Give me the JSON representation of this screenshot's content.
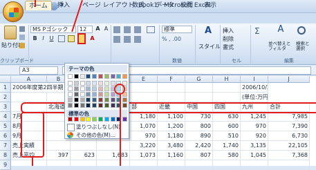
{
  "window": {
    "title": "Book1 - Microsoft Excel"
  },
  "tabs": [
    "ホーム",
    "挿入",
    "ページ レイアウト",
    "数式",
    "データ",
    "校閲",
    "表示"
  ],
  "ribbon": {
    "paste_label": "貼り付け",
    "clipboard_label": "クリップボード",
    "font_name": "MS Pゴシック",
    "font_size": "12",
    "number_format": "標準",
    "number_label": "数値",
    "style_label": "スタイル",
    "cells_insert": "挿入",
    "cells_delete": "削除",
    "cells_format": "書式",
    "cells_label": "セル",
    "sort_label": "並べ替えと\nフィルタ",
    "find_label": "検索と\n選択",
    "edit_label": "編集",
    "bold": "B",
    "italic": "I",
    "underline": "U",
    "font_color_glyph": "A"
  },
  "formula_bar": {
    "name_box": "A3"
  },
  "palette": {
    "theme_header": "テーマの色",
    "standard_header": "標準の色",
    "no_fill": "塗りつぶしなし(N)",
    "more_colors": "その他の色(M)...",
    "theme_top": [
      "#ffffff",
      "#000000",
      "#eeece1",
      "#1f497d",
      "#4f81bd",
      "#c0504d",
      "#9bbb59",
      "#8064a2",
      "#4bacc6",
      "#f79646"
    ],
    "standard": [
      "#c00000",
      "#ff0000",
      "#ffc000",
      "#ffff00",
      "#92d050",
      "#00b050",
      "#00b0f0",
      "#0070c0",
      "#002060",
      "#7030a0"
    ]
  },
  "sheet": {
    "columns": [
      "A",
      "B",
      "C",
      "D",
      "E",
      "F",
      "G",
      "H",
      "I",
      "J"
    ],
    "rows": [
      {
        "n": "1",
        "cells": [
          "2006年度第2四半期",
          "",
          "",
          "",
          "",
          "",
          "",
          "",
          "2006/10/25"
        ]
      },
      {
        "n": "2",
        "cells": [
          "",
          "",
          "",
          "",
          "",
          "",
          "",
          "",
          "(単位:万円)"
        ]
      },
      {
        "n": "3",
        "cells": [
          "",
          "北海道",
          "",
          "",
          "部",
          "近畿",
          "中国",
          "四国",
          "九州",
          "合計"
        ]
      },
      {
        "n": "4",
        "cells": [
          "7月",
          "",
          "",
          "",
          "1,180",
          "1,100",
          "730",
          "630",
          "1,245",
          "7,985"
        ]
      },
      {
        "n": "5",
        "cells": [
          "8月",
          "",
          "",
          "",
          "1,070",
          "1,200",
          "800",
          "600",
          "970",
          "7,390"
        ]
      },
      {
        "n": "6",
        "cells": [
          "9月",
          "",
          "",
          "",
          "970",
          "1,180",
          "890",
          "510",
          "920",
          "6,730"
        ]
      },
      {
        "n": "7",
        "cells": [
          "売上実績",
          "",
          "",
          "",
          "3,220",
          "3,480",
          "2,420",
          "1,740",
          "3,135",
          "22,105"
        ]
      },
      {
        "n": "8",
        "cells": [
          "売上平均",
          "397",
          "623",
          "1,683",
          "1,073",
          "1,160",
          "807",
          "580",
          "1,045",
          "7,368"
        ]
      },
      {
        "n": "9",
        "cells": [
          "",
          "",
          "",
          "",
          "",
          "",
          "",
          "",
          "",
          ""
        ]
      }
    ]
  }
}
